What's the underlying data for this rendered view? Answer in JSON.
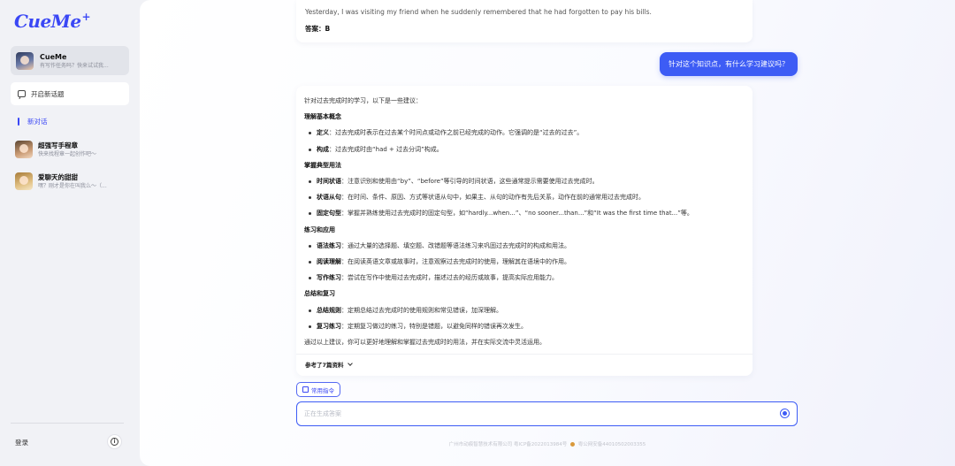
{
  "app": {
    "logo": "CueMe",
    "logo_mark": "+"
  },
  "sidebar": {
    "bot": {
      "name": "CueMe",
      "subtitle": "有写作任务吗？快来试试我..."
    },
    "new_chat_label": "开启新话题",
    "active_conversation": "新对话",
    "conversations": [
      {
        "title": "超强写手程章",
        "subtitle": "快来找程章一起创作吧～"
      },
      {
        "title": "爱聊天的甜甜",
        "subtitle": "嘿？刚才是你在叫我么～（..."
      }
    ],
    "login_label": "登录",
    "info_icon_glyph": "i"
  },
  "chat": {
    "previous": {
      "line": "Yesterday, I was visiting my friend when he suddenly remembered that he had forgotten to pay his bills.",
      "answer": "答案：B"
    },
    "user_message": "针对这个知识点，有什么学习建议吗？",
    "answer": {
      "intro": "针对过去完成时的学习，以下是一些建议：",
      "sections": [
        {
          "heading": "理解基本概念",
          "items": [
            {
              "term": "定义",
              "text": "：过去完成时表示在过去某个时间点或动作之前已经完成的动作。它强调的是“过去的过去”。"
            },
            {
              "term": "构成",
              "text": "：过去完成时由“had + 过去分词”构成。"
            }
          ]
        },
        {
          "heading": "掌握典型用法",
          "items": [
            {
              "term": "时间状语",
              "text": "：注意识别和使用由“by”、“before”等引导的时间状语，这些通常提示需要使用过去完成时。"
            },
            {
              "term": "状语从句",
              "text": "：在时间、条件、原因、方式等状语从句中，如果主、从句的动作有先后关系，动作在前的通常用过去完成时。"
            },
            {
              "term": "固定句型",
              "text": "：掌握并熟练使用过去完成时的固定句型，如“hardly...when...”、“no sooner...than...”和“It was the first time that...”等。"
            }
          ]
        },
        {
          "heading": "练习和应用",
          "items": [
            {
              "term": "语法练习",
              "text": "：通过大量的选择题、填空题、改错题等语法练习来巩固过去完成时的构成和用法。"
            },
            {
              "term": "阅读理解",
              "text": "：在阅读英语文章或故事时，注意观察过去完成时的使用，理解其在语境中的作用。"
            },
            {
              "term": "写作练习",
              "text": "：尝试在写作中使用过去完成时，描述过去的经历或故事，提高实际应用能力。"
            }
          ]
        },
        {
          "heading": "总结和复习",
          "items": [
            {
              "term": "总结规则",
              "text": "：定期总结过去完成时的使用规则和常见错误，加深理解。"
            },
            {
              "term": "复习练习",
              "text": "：定期复习做过的练习，特别是错题，以避免同样的错误再次发生。"
            }
          ]
        }
      ],
      "conclusion": "通过以上建议，你可以更好地理解和掌握过去完成时的用法，并在实际交流中灵活运用。",
      "references_label": "参考了7篇资料"
    }
  },
  "composer": {
    "command_button": "常用指令",
    "placeholder": "正在生成答案"
  },
  "footer": {
    "icp": "广州市动痕智慧技术有限公司 粤ICP备2022013984号",
    "police": "粤公网安备44010502003355"
  },
  "colors": {
    "accent": "#3d5cf5",
    "sidebar_bg": "#f1f2f6"
  }
}
